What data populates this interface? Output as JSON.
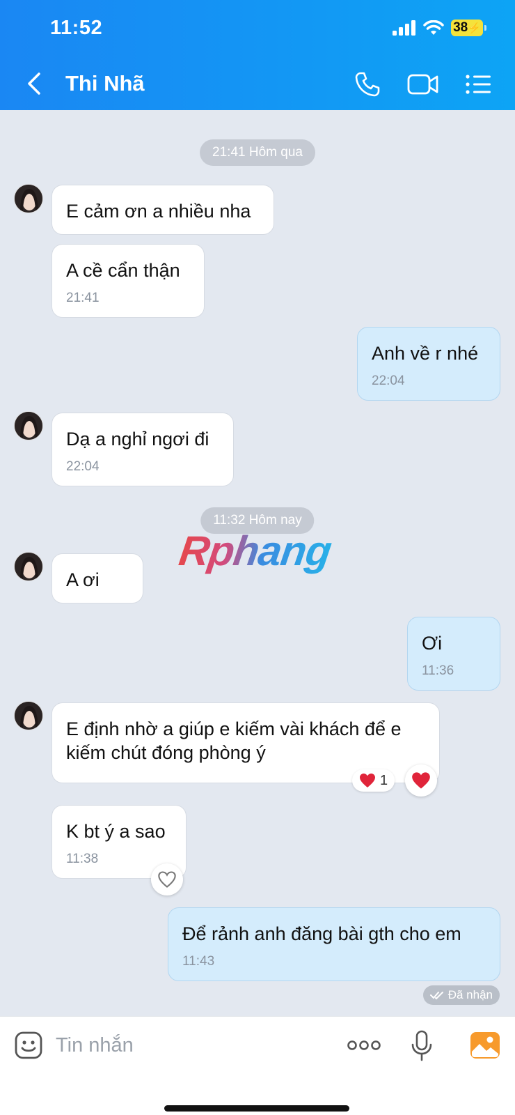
{
  "status_bar": {
    "time": "11:52",
    "battery": "38"
  },
  "header": {
    "title": "Thi Nhã",
    "back_icon": "chevron-left-icon",
    "call_icon": "phone-icon",
    "video_icon": "video-camera-icon",
    "menu_icon": "list-menu-icon"
  },
  "timestamps": {
    "yesterday": "21:41 Hôm qua",
    "today": "11:32 Hôm nay"
  },
  "messages": [
    {
      "from": "them",
      "text": "E cảm ơn a nhiều nha",
      "time": ""
    },
    {
      "from": "them",
      "text": "A cề cẩn thận",
      "time": "21:41"
    },
    {
      "from": "me",
      "text": "Anh về r nhé",
      "time": "22:04"
    },
    {
      "from": "them",
      "text": "Dạ a nghỉ ngơi đi",
      "time": "22:04"
    },
    {
      "from": "them",
      "text": "A ơi",
      "time": ""
    },
    {
      "from": "me",
      "text": "Ơi",
      "time": "11:36"
    },
    {
      "from": "them",
      "text": "E định nhờ a giúp e kiếm vài khách để e kiếm chút đóng phòng ý",
      "time": "",
      "reaction_count": "1"
    },
    {
      "from": "them",
      "text": "K bt ý a sao",
      "time": "11:38"
    },
    {
      "from": "me",
      "text": "Để rảnh anh đăng bài gth cho em",
      "time": "11:43"
    }
  ],
  "delivery_status": "Đã nhận",
  "watermark": "Rphang",
  "input": {
    "placeholder": "Tin nhắn"
  },
  "colors": {
    "header_start": "#1a87f3",
    "header_end": "#0da4f5",
    "outgoing_bubble": "#d4ecfc",
    "incoming_bubble": "#ffffff",
    "heart": "#e0243a"
  }
}
